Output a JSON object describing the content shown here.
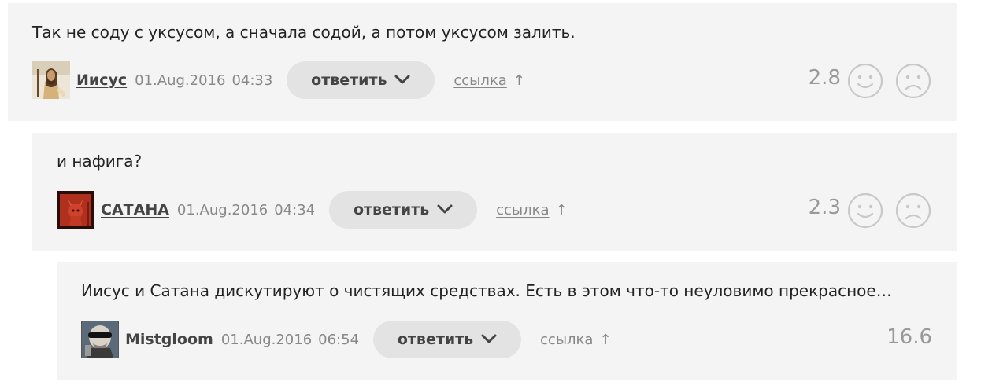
{
  "comments": [
    {
      "text": "Так не соду с уксусом, а сначала содой, а потом уксусом залить.",
      "author": "Иисус",
      "date": "01.Aug.2016",
      "time": "04:33",
      "reply_label": "ответить",
      "link_label": "ссылка",
      "link_arrow": "↑",
      "score": "2.8"
    },
    {
      "text": "и нафига?",
      "author": "САТАНА",
      "date": "01.Aug.2016",
      "time": "04:34",
      "reply_label": "ответить",
      "link_label": "ссылка",
      "link_arrow": "↑",
      "score": "2.3"
    },
    {
      "text": "Иисус и Сатана дискутируют о чистящих средствах. Есть в этом что-то неуловимо прекрасное…",
      "author": "Mistgloom",
      "date": "01.Aug.2016",
      "time": "06:54",
      "reply_label": "ответить",
      "link_label": "ссылка",
      "link_arrow": "↑",
      "score": "16.6"
    }
  ],
  "icons": {
    "chevron": "chevron-down-icon",
    "like": "smile-icon",
    "dislike": "frown-icon"
  },
  "colors": {
    "card_bg": "#f4f4f4",
    "button_bg": "#e3e3e3",
    "muted_text": "#888888"
  }
}
